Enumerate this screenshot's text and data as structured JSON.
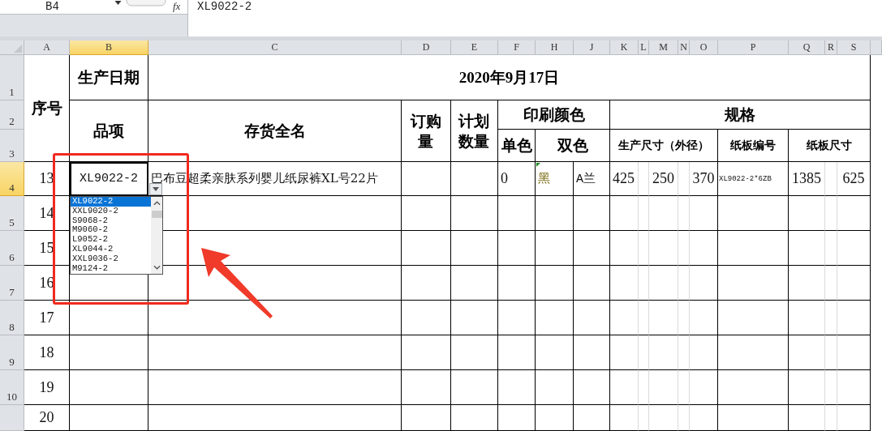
{
  "formula_bar": {
    "name_box": "B4",
    "function_label": "fx",
    "formula": "XL9022-2"
  },
  "column_headers": [
    {
      "label": "A",
      "selected": false
    },
    {
      "label": "B",
      "selected": true
    },
    {
      "label": "C",
      "selected": false
    },
    {
      "label": "D",
      "selected": false
    },
    {
      "label": "E",
      "selected": false
    },
    {
      "label": "F",
      "selected": false
    },
    {
      "label": "H",
      "selected": false
    },
    {
      "label": "J",
      "selected": false
    },
    {
      "label": "K",
      "selected": false
    },
    {
      "label": "L",
      "selected": false
    },
    {
      "label": "M",
      "selected": false
    },
    {
      "label": "N",
      "selected": false
    },
    {
      "label": "O",
      "selected": false
    },
    {
      "label": "P",
      "selected": false
    },
    {
      "label": "Q",
      "selected": false
    },
    {
      "label": "R",
      "selected": false
    },
    {
      "label": "S",
      "selected": false
    }
  ],
  "row_headers": [
    {
      "label": "1",
      "selected": false
    },
    {
      "label": "2",
      "selected": false
    },
    {
      "label": "3",
      "selected": false
    },
    {
      "label": "4",
      "selected": true
    },
    {
      "label": "5",
      "selected": false
    },
    {
      "label": "6",
      "selected": false
    },
    {
      "label": "7",
      "selected": false
    },
    {
      "label": "8",
      "selected": false
    },
    {
      "label": "9",
      "selected": false
    },
    {
      "label": "10",
      "selected": false
    }
  ],
  "sheet": {
    "seq": "序号",
    "date_label": "生产日期",
    "date": "2020年9月17日",
    "item": "品项",
    "full_name": "存货全名",
    "order_qty": "订购量",
    "plan_qty": "计划数量",
    "print_color": "印刷颜色",
    "spec": "规格",
    "single": "单色",
    "dual": "双色",
    "size": "生产尺寸（外径）",
    "board_no": "纸板编号",
    "board_size": "纸板尺寸"
  },
  "rows": [
    {
      "no": "13",
      "item": "XL9022-2",
      "name": "巴布豆超柔亲肤系列婴儿纸尿裤XL号22片",
      "single": "0",
      "dual_1": "黑",
      "dual_2": "A兰",
      "size_1": "425",
      "size_2": "250",
      "size_3": "370",
      "board_no": "XL9022-2*6ZB",
      "board_1": "1385",
      "board_2": "625"
    },
    {
      "no": "14"
    },
    {
      "no": "15"
    },
    {
      "no": "16"
    },
    {
      "no": "17"
    },
    {
      "no": "18"
    },
    {
      "no": "19"
    },
    {
      "no": "20"
    }
  ],
  "dropdown": {
    "options": [
      {
        "label": "XL9022-2",
        "selected": true
      },
      {
        "label": "XXL9020-2",
        "selected": false
      },
      {
        "label": "S9068-2",
        "selected": false
      },
      {
        "label": "M9060-2",
        "selected": false
      },
      {
        "label": "L9052-2",
        "selected": false
      },
      {
        "label": "XL9044-2",
        "selected": false
      },
      {
        "label": "XXL9036-2",
        "selected": false
      },
      {
        "label": "M9124-2",
        "selected": false
      }
    ]
  }
}
